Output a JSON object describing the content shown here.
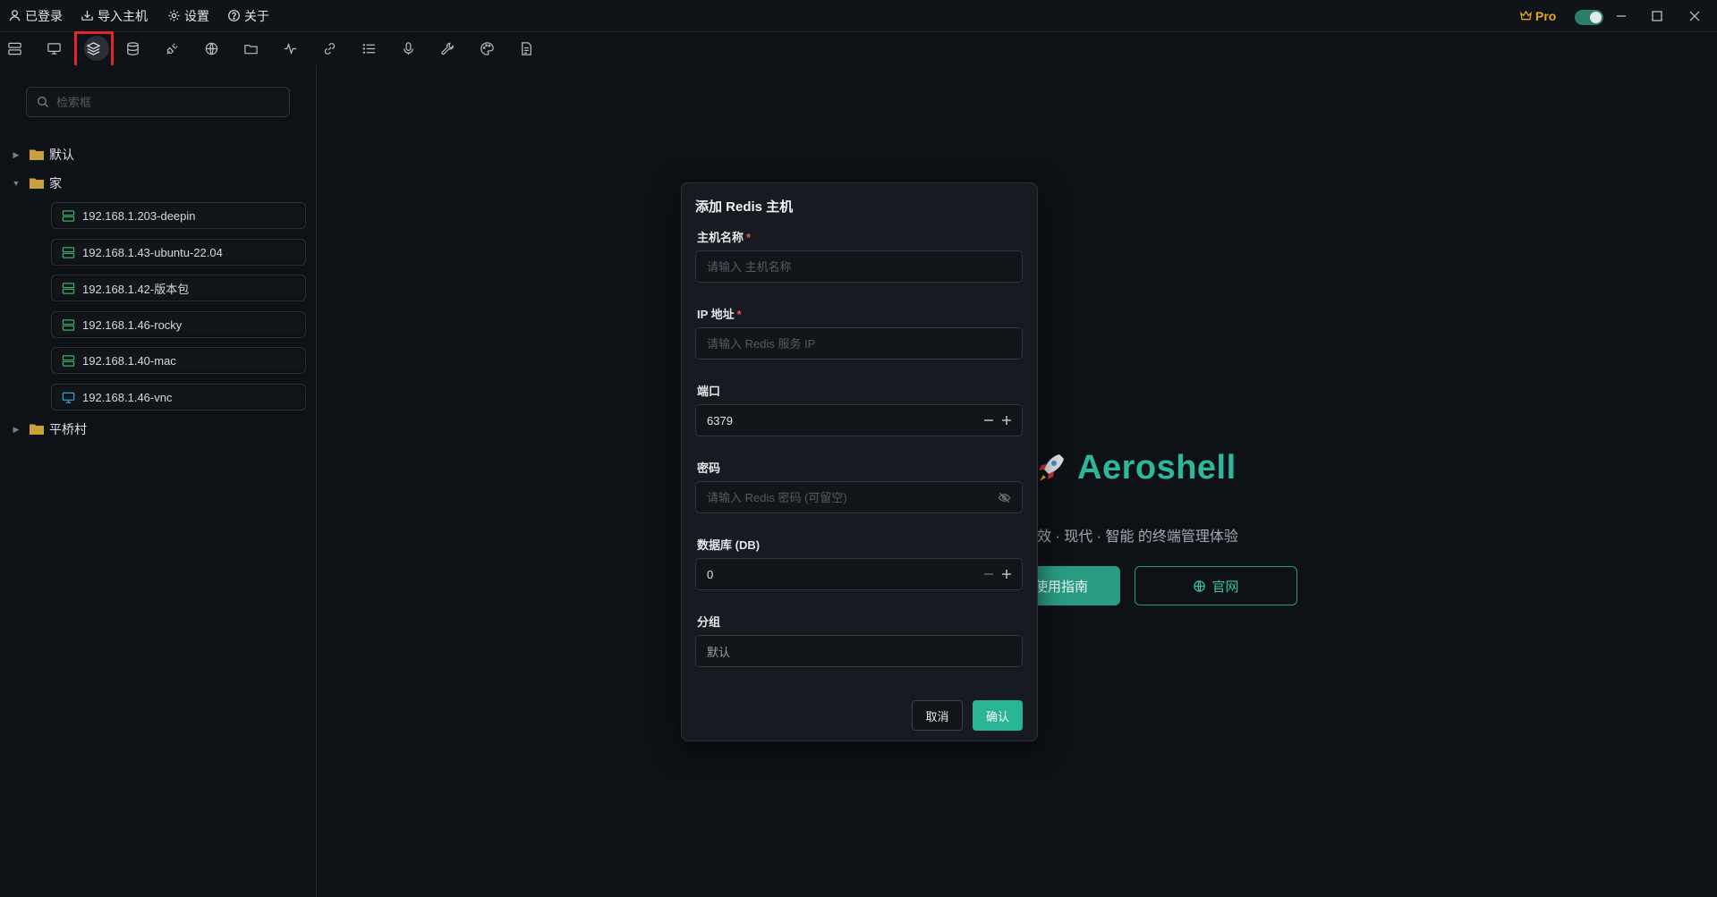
{
  "menubar": {
    "login": "已登录",
    "import": "导入主机",
    "settings": "设置",
    "about": "关于",
    "pro": "Pro"
  },
  "toolbar": {
    "items": [
      "hosts-icon",
      "desktop-icon",
      "redis-layers-icon",
      "database-icon",
      "plug-icon",
      "globe-icon",
      "folder-icon",
      "activity-icon",
      "link-icon",
      "list-icon",
      "mic-icon",
      "wrench-icon",
      "palette-icon",
      "document-icon"
    ],
    "active": "redis-layers-icon"
  },
  "sidebar": {
    "search_placeholder": "检索框",
    "groups": [
      {
        "label": "默认",
        "expanded": false
      },
      {
        "label": "家",
        "expanded": true
      },
      {
        "label": "平桥村",
        "expanded": false
      }
    ],
    "hosts": [
      {
        "label": "192.168.1.203-deepin",
        "type": "server"
      },
      {
        "label": "192.168.1.43-ubuntu-22.04",
        "type": "server"
      },
      {
        "label": "192.168.1.42-版本包",
        "type": "server"
      },
      {
        "label": "192.168.1.46-rocky",
        "type": "server"
      },
      {
        "label": "192.168.1.40-mac",
        "type": "server"
      },
      {
        "label": "192.168.1.46-vnc",
        "type": "desktop"
      }
    ]
  },
  "welcome": {
    "title": "Aeroshell",
    "subtitle": "效 · 现代 · 智能 的终端管理体验",
    "guide_button": "使用指南",
    "site_button": "官网"
  },
  "modal": {
    "title": "添加 Redis 主机",
    "name_label": "主机名称",
    "name_placeholder": "请输入 主机名称",
    "ip_label": "IP 地址",
    "ip_placeholder": "请输入 Redis 服务 IP",
    "port_label": "端口",
    "port_value": "6379",
    "password_label": "密码",
    "password_placeholder": "请输入 Redis 密码 (可留空)",
    "db_label": "数据库 (DB)",
    "db_value": "0",
    "group_label": "分组",
    "group_value": "默认",
    "required_mark": "*",
    "cancel": "取消",
    "confirm": "确认"
  },
  "colors": {
    "accent": "#2bb597",
    "highlight": "#e3262c",
    "pro": "#e0a820",
    "folder": "#c9a13b",
    "server_icon": "#3fae6a",
    "desktop_icon": "#3f9fd0"
  }
}
